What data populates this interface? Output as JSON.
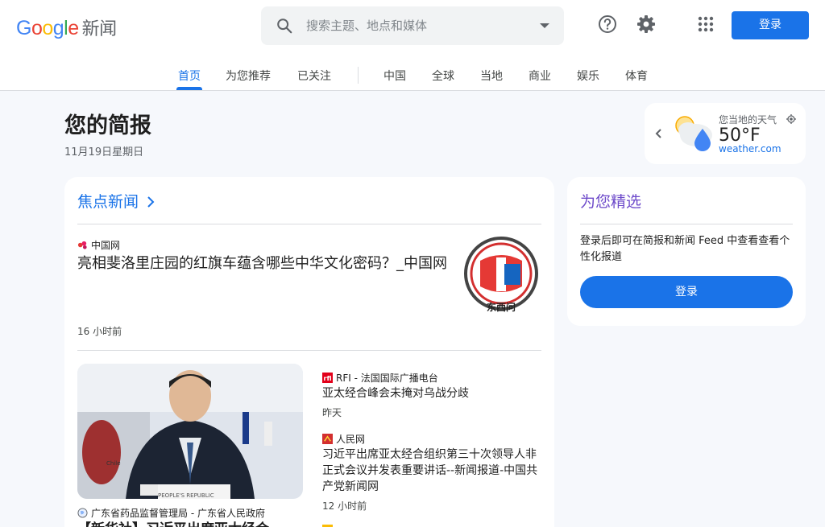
{
  "header": {
    "logo_google": "Google",
    "logo_news": "新闻",
    "search_placeholder": "搜索主题、地点和媒体",
    "login_label": "登录"
  },
  "nav": {
    "tabs": [
      "首页",
      "为您推荐",
      "已关注",
      "中国",
      "全球",
      "当地",
      "商业",
      "娱乐",
      "体育"
    ],
    "active": "首页"
  },
  "briefing": {
    "title": "您的简报",
    "date": "11月19日星期日"
  },
  "weather": {
    "label": "您当地的天气",
    "temp": "50°F",
    "source": "weather.com"
  },
  "top_stories": {
    "title": "焦点新闻",
    "lead": {
      "source": "中国网",
      "headline": "亮相斐洛里庄园的红旗车蕴含哪些中华文化密码？_中国网",
      "time": "16 小时前",
      "thumb_caption": "东西问"
    },
    "photo_story": {
      "source": "广东省药品监督管理局 - 广东省人民政府",
      "headline": "【新华社】习近平出席亚太经合",
      "placard_left": "Chile",
      "placard_bottom": "PEOPLE'S REPUBLIC"
    },
    "side_items": [
      {
        "source": "RFI - 法国国际广播电台",
        "headline": "亚太经合峰会未掩对乌战分歧",
        "time": "昨天"
      },
      {
        "source": "人民网",
        "headline": "习近平出席亚太经合组织第三十次领导人非正式会议并发表重要讲话--新闻报道-中国共产党新闻网",
        "time": "12 小时前"
      }
    ]
  },
  "picks": {
    "title": "为您精选",
    "text": "登录后即可在简报和新闻 Feed 中查看查看个性化报道",
    "button": "登录"
  },
  "colors": {
    "accent": "#1a73e8",
    "picks_title": "#6d4aca",
    "background": "#f6f8fc"
  }
}
